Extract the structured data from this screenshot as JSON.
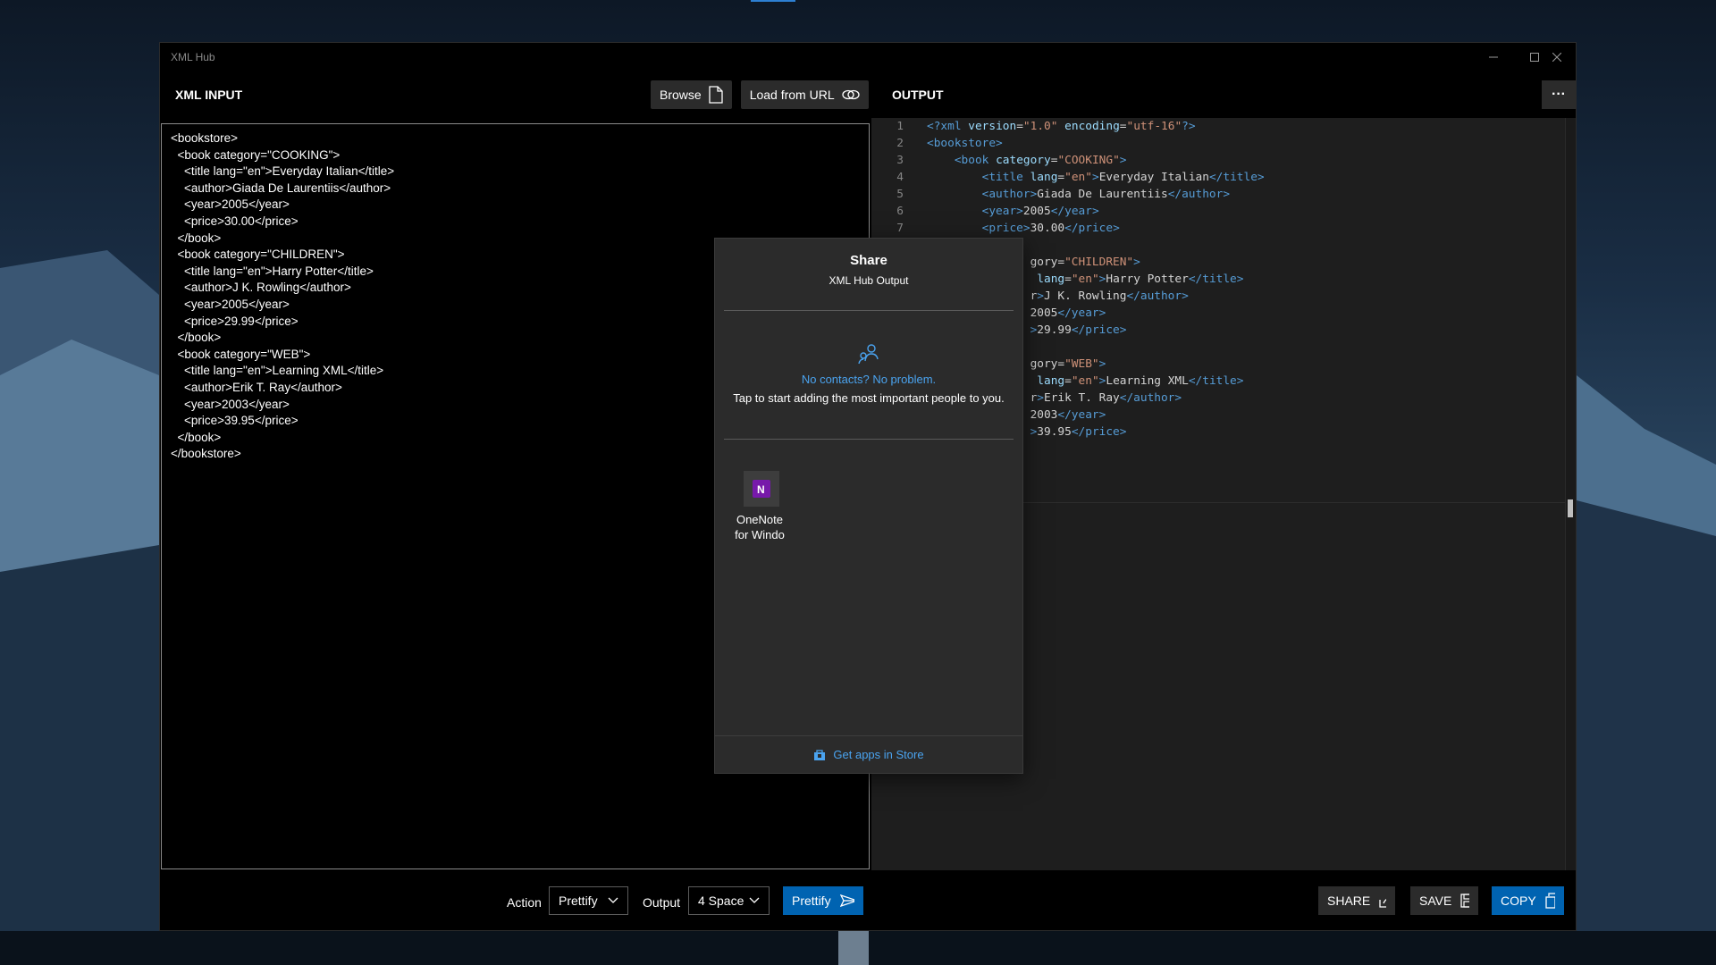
{
  "window": {
    "title": "XML Hub",
    "controls": {
      "minimize": "—",
      "maximize": "☐",
      "close": "✕"
    }
  },
  "input_panel": {
    "label": "XML INPUT",
    "browse_label": "Browse",
    "load_url_label": "Load from URL",
    "content": "<bookstore>\n  <book category=\"COOKING\">\n    <title lang=\"en\">Everyday Italian</title>\n    <author>Giada De Laurentiis</author>\n    <year>2005</year>\n    <price>30.00</price>\n  </book>\n  <book category=\"CHILDREN\">\n    <title lang=\"en\">Harry Potter</title>\n    <author>J K. Rowling</author>\n    <year>2005</year>\n    <price>29.99</price>\n  </book>\n  <book category=\"WEB\">\n    <title lang=\"en\">Learning XML</title>\n    <author>Erik T. Ray</author>\n    <year>2003</year>\n    <price>39.95</price>\n  </book>\n</bookstore>"
  },
  "output_panel": {
    "label": "OUTPUT",
    "more_label": "···",
    "line_numbers": [
      "1",
      "2",
      "3",
      "4",
      "5",
      "6",
      "7"
    ],
    "lines": [
      "<?xml version=\"1.0\" encoding=\"utf-16\"?>",
      "<bookstore>",
      "    <book category=\"COOKING\">",
      "        <title lang=\"en\">Everyday Italian</title>",
      "        <author>Giada De Laurentiis</author>",
      "        <year>2005</year>",
      "        <price>30.00</price>",
      "",
      "               gory=\"CHILDREN\">",
      "                lang=\"en\">Harry Potter</title>",
      "               r>J K. Rowling</author>",
      "               2005</year>",
      "               >29.99</price>",
      "",
      "               gory=\"WEB\">",
      "                lang=\"en\">Learning XML</title>",
      "               r>Erik T. Ray</author>",
      "               2003</year>",
      "               >39.95</price>"
    ]
  },
  "bottom_bar": {
    "action_label": "Action",
    "action_value": "Prettify",
    "output_label": "Output",
    "output_value": "4 Space",
    "run_label": "Prettify",
    "share_label": "SHARE",
    "save_label": "SAVE",
    "copy_label": "COPY"
  },
  "share_flyout": {
    "title": "Share",
    "subtitle": "XML Hub Output",
    "no_contacts": "No contacts? No problem.",
    "tap_hint": "Tap to start adding the most important people to you.",
    "app_name_line1": "OneNote",
    "app_name_line2": "for Windo",
    "store_link": "Get apps in Store",
    "icons": [
      "contacts-icon",
      "onenote-icon",
      "store-icon"
    ]
  },
  "colors": {
    "accent": "#0063b1",
    "link": "#4aa3ef",
    "tag": "#569cd6",
    "attr": "#9cdcfe",
    "value": "#ce9178"
  }
}
